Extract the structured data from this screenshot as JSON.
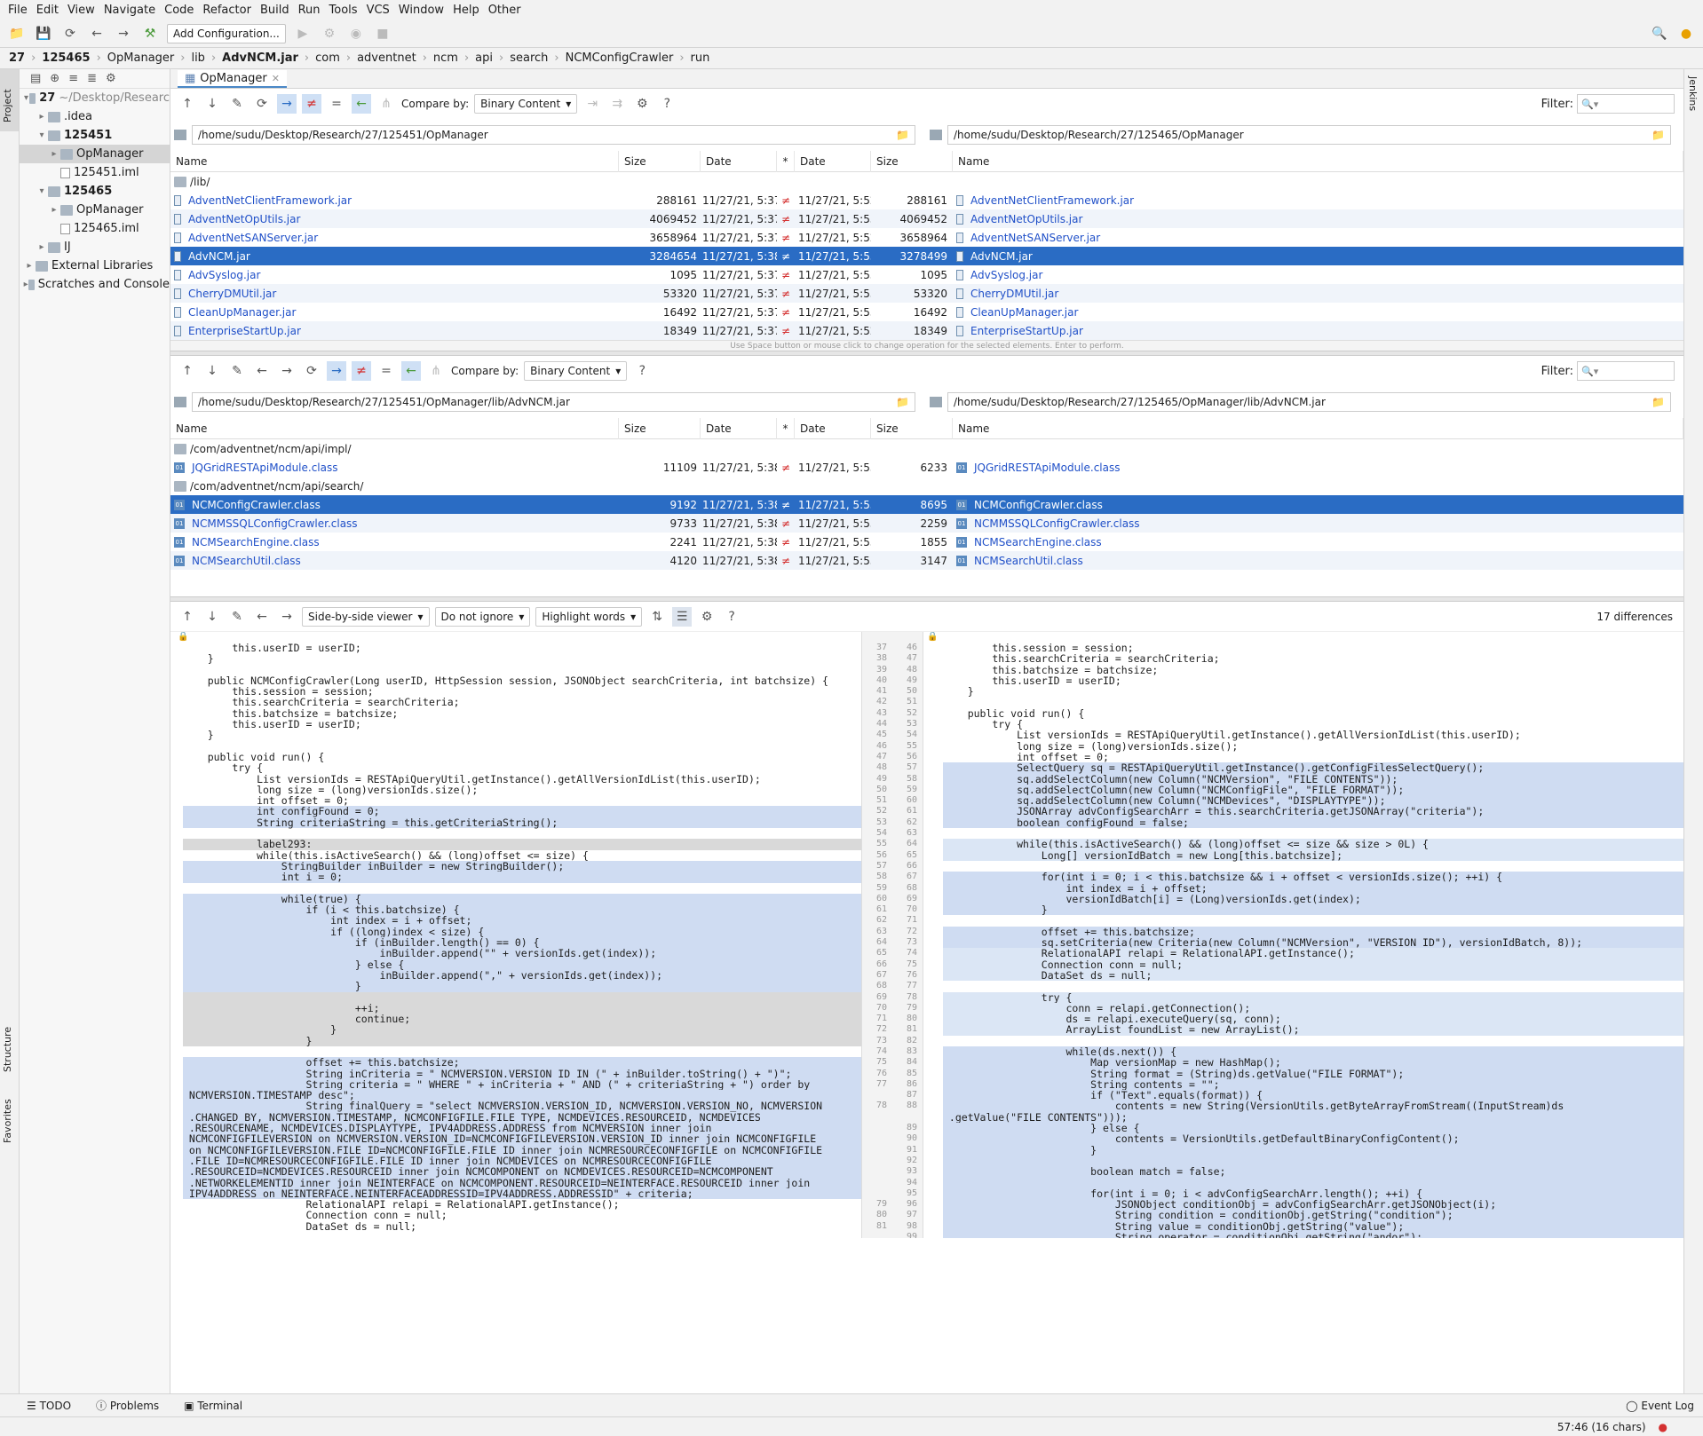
{
  "menu": [
    "File",
    "Edit",
    "View",
    "Navigate",
    "Code",
    "Refactor",
    "Build",
    "Run",
    "Tools",
    "VCS",
    "Window",
    "Help",
    "Other"
  ],
  "toolbar": {
    "add_config": "Add Configuration..."
  },
  "breadcrumb": [
    "27",
    "125465",
    "OpManager",
    "lib",
    "AdvNCM.jar",
    "com",
    "adventnet",
    "ncm",
    "api",
    "search",
    "NCMConfigCrawler",
    "run"
  ],
  "left_tabs": {
    "project": "Project",
    "structure": "Structure",
    "favorites": "Favorites"
  },
  "right_tabs": {
    "jenkins": "Jenkins"
  },
  "project_tree": [
    {
      "label": "27",
      "extra": "~/Desktop/Researc",
      "depth": 0,
      "bold": true
    },
    {
      "label": ".idea",
      "depth": 1
    },
    {
      "label": "125451",
      "depth": 1,
      "bold": true
    },
    {
      "label": "OpManager",
      "depth": 2,
      "selected": true
    },
    {
      "label": "125451.iml",
      "depth": 2
    },
    {
      "label": "125465",
      "depth": 1,
      "bold": true
    },
    {
      "label": "OpManager",
      "depth": 2
    },
    {
      "label": "125465.iml",
      "depth": 2
    },
    {
      "label": "IJ",
      "depth": 1
    },
    {
      "label": "External Libraries",
      "depth": 0
    },
    {
      "label": "Scratches and Console",
      "depth": 0
    }
  ],
  "tab": {
    "label": "OpManager"
  },
  "compare": {
    "label": "Compare by:",
    "value": "Binary Content",
    "filter_label": "Filter:"
  },
  "panel1": {
    "left_path": "/home/sudu/Desktop/Research/27/125451/OpManager",
    "right_path": "/home/sudu/Desktop/Research/27/125465/OpManager",
    "headers": [
      "Name",
      "Size",
      "Date",
      "*",
      "Date",
      "Size",
      "Name"
    ],
    "dir": "/lib/",
    "rows": [
      {
        "name": "AdventNetClientFramework.jar",
        "lsize": "288161",
        "ldate": "11/27/21, 5:37 P...",
        "rdate": "11/27/21, 5:52 P...",
        "rsize": "288161"
      },
      {
        "name": "AdventNetOpUtils.jar",
        "lsize": "4069452",
        "ldate": "11/27/21, 5:37 P...",
        "rdate": "11/27/21, 5:53 P...",
        "rsize": "4069452"
      },
      {
        "name": "AdventNetSANServer.jar",
        "lsize": "3658964",
        "ldate": "11/27/21, 5:37 P...",
        "rdate": "11/27/21, 5:52 P...",
        "rsize": "3658964"
      },
      {
        "name": "AdvNCM.jar",
        "lsize": "3284654",
        "ldate": "11/27/21, 5:38 P...",
        "rdate": "11/27/21, 5:53 P...",
        "rsize": "3278499",
        "selected": true
      },
      {
        "name": "AdvSyslog.jar",
        "lsize": "1095",
        "ldate": "11/27/21, 5:37 P...",
        "rdate": "11/27/21, 5:53 P...",
        "rsize": "1095"
      },
      {
        "name": "CherryDMUtil.jar",
        "lsize": "53320",
        "ldate": "11/27/21, 5:37 P...",
        "rdate": "11/27/21, 5:53 P...",
        "rsize": "53320"
      },
      {
        "name": "CleanUpManager.jar",
        "lsize": "16492",
        "ldate": "11/27/21, 5:37 P...",
        "rdate": "11/27/21, 5:53 P...",
        "rsize": "16492"
      },
      {
        "name": "EnterpriseStartUp.jar",
        "lsize": "18349",
        "ldate": "11/27/21, 5:37 P...",
        "rdate": "11/27/21, 5:52 P...",
        "rsize": "18349"
      }
    ],
    "hint": "Use Space button or mouse click to change operation for the selected elements. Enter to perform."
  },
  "panel2": {
    "left_path": "/home/sudu/Desktop/Research/27/125451/OpManager/lib/AdvNCM.jar",
    "right_path": "/home/sudu/Desktop/Research/27/125465/OpManager/lib/AdvNCM.jar",
    "dir1": "/com/adventnet/ncm/api/impl/",
    "dir2": "/com/adventnet/ncm/api/search/",
    "row_impl": {
      "name": "JQGridRESTApiModule.class",
      "lsize": "11109",
      "ldate": "11/27/21, 5:38 P...",
      "rdate": "11/27/21, 5:53 P...",
      "rsize": "6233"
    },
    "rows": [
      {
        "name": "NCMConfigCrawler.class",
        "lsize": "9192",
        "ldate": "11/27/21, 5:38 P...",
        "rdate": "11/27/21, 5:53 P...",
        "rsize": "8695",
        "selected": true
      },
      {
        "name": "NCMMSSQLConfigCrawler.class",
        "lsize": "9733",
        "ldate": "11/27/21, 5:38 P...",
        "rdate": "11/27/21, 5:53 P...",
        "rsize": "2259"
      },
      {
        "name": "NCMSearchEngine.class",
        "lsize": "2241",
        "ldate": "11/27/21, 5:38 P...",
        "rdate": "11/27/21, 5:53 P...",
        "rsize": "1855"
      },
      {
        "name": "NCMSearchUtil.class",
        "lsize": "4120",
        "ldate": "11/27/21, 5:38 P...",
        "rdate": "11/27/21, 5:53 P...",
        "rsize": "3147"
      }
    ]
  },
  "diff": {
    "viewer": "Side-by-side viewer",
    "ignore": "Do not ignore",
    "highlight": "Highlight words",
    "count": "17 differences",
    "left_lines": [
      {
        "t": "        this.userID = userID;",
        "n": "37"
      },
      {
        "t": "    }",
        "n": "38"
      },
      {
        "t": "",
        "n": "39"
      },
      {
        "t": "    public NCMConfigCrawler(Long userID, HttpSession session, JSONObject searchCriteria, int batchsize) {",
        "n": "40"
      },
      {
        "t": "        this.session = session;",
        "n": "41"
      },
      {
        "t": "        this.searchCriteria = searchCriteria;",
        "n": "42"
      },
      {
        "t": "        this.batchsize = batchsize;",
        "n": "43"
      },
      {
        "t": "        this.userID = userID;",
        "n": "44"
      },
      {
        "t": "    }",
        "n": "45"
      },
      {
        "t": "",
        "n": "46"
      },
      {
        "t": "    public void run() {",
        "n": "47"
      },
      {
        "t": "        try {",
        "n": "48"
      },
      {
        "t": "            List versionIds = RESTApiQueryUtil.getInstance().getAllVersionIdList(this.userID);",
        "n": "49"
      },
      {
        "t": "            long size = (long)versionIds.size();",
        "n": "50"
      },
      {
        "t": "            int offset = 0;",
        "n": "51"
      },
      {
        "t": "            int configFound = 0;",
        "n": "52",
        "c": "chg"
      },
      {
        "t": "            String criteriaString = this.getCriteriaString();",
        "n": "53",
        "c": "chg"
      },
      {
        "t": "",
        "n": "54"
      },
      {
        "t": "            label293:",
        "n": "55",
        "c": "del"
      },
      {
        "t": "            while(this.isActiveSearch() && (long)offset <= size) {",
        "n": "56"
      },
      {
        "t": "                StringBuilder inBuilder = new StringBuilder();",
        "n": "57",
        "c": "chg"
      },
      {
        "t": "                int i = 0;",
        "n": "58",
        "c": "chg"
      },
      {
        "t": "",
        "n": "59"
      },
      {
        "t": "                while(true) {",
        "n": "60",
        "c": "chg"
      },
      {
        "t": "                    if (i < this.batchsize) {",
        "n": "61",
        "c": "chg"
      },
      {
        "t": "                        int index = i + offset;",
        "n": "62",
        "c": "chg"
      },
      {
        "t": "                        if ((long)index < size) {",
        "n": "63",
        "c": "chg"
      },
      {
        "t": "                            if (inBuilder.length() == 0) {",
        "n": "64",
        "c": "chg"
      },
      {
        "t": "                                inBuilder.append(\"\" + versionIds.get(index));",
        "n": "65",
        "c": "chg"
      },
      {
        "t": "                            } else {",
        "n": "66",
        "c": "chg"
      },
      {
        "t": "                                inBuilder.append(\",\" + versionIds.get(index));",
        "n": "67",
        "c": "chg"
      },
      {
        "t": "                            }",
        "n": "68",
        "c": "chg"
      },
      {
        "t": "",
        "n": "69",
        "c": "del"
      },
      {
        "t": "                            ++i;",
        "n": "70",
        "c": "del"
      },
      {
        "t": "                            continue;",
        "n": "71",
        "c": "del"
      },
      {
        "t": "                        }",
        "n": "72",
        "c": "del"
      },
      {
        "t": "                    }",
        "n": "73",
        "c": "del"
      },
      {
        "t": "",
        "n": "74"
      },
      {
        "t": "                    offset += this.batchsize;",
        "n": "75",
        "c": "chg"
      },
      {
        "t": "                    String inCriteria = \" NCMVERSION.VERSION_ID IN (\" + inBuilder.toString() + \")\";",
        "n": "76",
        "c": "chg"
      },
      {
        "t": "                    String criteria = \" WHERE \" + inCriteria + \" AND (\" + criteriaString + \") order by",
        "n": "77",
        "c": "chg"
      },
      {
        "t": " NCMVERSION.TIMESTAMP desc\";",
        "n": "",
        "c": "chg"
      },
      {
        "t": "                    String finalQuery = \"select NCMVERSION.VERSION_ID, NCMVERSION.VERSION_NO, NCMVERSION",
        "n": "78",
        "c": "chg"
      },
      {
        "t": " .CHANGED_BY, NCMVERSION.TIMESTAMP, NCMCONFIGFILE.FILE_TYPE, NCMDEVICES.RESOURCEID, NCMDEVICES",
        "n": "",
        "c": "chg"
      },
      {
        "t": " .RESOURCENAME, NCMDEVICES.DISPLAYTYPE, IPV4ADDRESS.ADDRESS from NCMVERSION inner join",
        "n": "",
        "c": "chg"
      },
      {
        "t": " NCMCONFIGFILEVERSION on NCMVERSION.VERSION_ID=NCMCONFIGFILEVERSION.VERSION_ID inner join NCMCONFIGFILE",
        "n": "",
        "c": "chg"
      },
      {
        "t": " on NCMCONFIGFILEVERSION.FILE_ID=NCMCONFIGFILE.FILE_ID inner join NCMRESOURCECONFIGFILE on NCMCONFIGFILE",
        "n": "",
        "c": "chg"
      },
      {
        "t": " .FILE_ID=NCMRESOURCECONFIGFILE.FILE_ID inner join NCMDEVICES on NCMRESOURCECONFIGFILE",
        "n": "",
        "c": "chg"
      },
      {
        "t": " .RESOURCEID=NCMDEVICES.RESOURCEID inner join NCMCOMPONENT on NCMDEVICES.RESOURCEID=NCMCOMPONENT",
        "n": "",
        "c": "chg"
      },
      {
        "t": " .NETWORKELEMENTID inner join NEINTERFACE on NCMCOMPONENT.RESOURCEID=NEINTERFACE.RESOURCEID inner join",
        "n": "",
        "c": "chg"
      },
      {
        "t": " IPV4ADDRESS on NEINTERFACE.NEINTERFACEADDRESSID=IPV4ADDRESS.ADDRESSID\" + criteria;",
        "n": "",
        "c": "chg"
      },
      {
        "t": "                    RelationalAPI relapi = RelationalAPI.getInstance();",
        "n": "79"
      },
      {
        "t": "                    Connection conn = null;",
        "n": "80"
      },
      {
        "t": "                    DataSet ds = null;",
        "n": "81"
      }
    ],
    "right_lines": [
      {
        "t": "        this.session = session;",
        "n": "46"
      },
      {
        "t": "        this.searchCriteria = searchCriteria;",
        "n": "47"
      },
      {
        "t": "        this.batchsize = batchsize;",
        "n": "48"
      },
      {
        "t": "        this.userID = userID;",
        "n": "49"
      },
      {
        "t": "    }",
        "n": "50"
      },
      {
        "t": "",
        "n": "51"
      },
      {
        "t": "    public void run() {",
        "n": "52"
      },
      {
        "t": "        try {",
        "n": "53"
      },
      {
        "t": "            List versionIds = RESTApiQueryUtil.getInstance().getAllVersionIdList(this.userID);",
        "n": "54"
      },
      {
        "t": "            long size = (long)versionIds.size();",
        "n": "55"
      },
      {
        "t": "            int offset = 0;",
        "n": "56"
      },
      {
        "t": "            SelectQuery sq = RESTApiQueryUtil.getInstance().getConfigFilesSelectQuery();",
        "n": "57",
        "c": "chg"
      },
      {
        "t": "            sq.addSelectColumn(new Column(\"NCMVersion\", \"FILE_CONTENTS\"));",
        "n": "58",
        "c": "chg"
      },
      {
        "t": "            sq.addSelectColumn(new Column(\"NCMConfigFile\", \"FILE_FORMAT\"));",
        "n": "59",
        "c": "chg"
      },
      {
        "t": "            sq.addSelectColumn(new Column(\"NCMDevices\", \"DISPLAYTYPE\"));",
        "n": "60",
        "c": "chg"
      },
      {
        "t": "            JSONArray advConfigSearchArr = this.searchCriteria.getJSONArray(\"criteria\");",
        "n": "61",
        "c": "chg"
      },
      {
        "t": "            boolean configFound = false;",
        "n": "62",
        "c": "chg"
      },
      {
        "t": "",
        "n": "63"
      },
      {
        "t": "            while(this.isActiveSearch() && (long)offset <= size && size > 0L) {",
        "n": "64",
        "c": "ins"
      },
      {
        "t": "                Long[] versionIdBatch = new Long[this.batchsize];",
        "n": "65",
        "c": "ins"
      },
      {
        "t": "",
        "n": "66"
      },
      {
        "t": "                for(int i = 0; i < this.batchsize && i + offset < versionIds.size(); ++i) {",
        "n": "67",
        "c": "chg"
      },
      {
        "t": "                    int index = i + offset;",
        "n": "68",
        "c": "chg"
      },
      {
        "t": "                    versionIdBatch[i] = (Long)versionIds.get(index);",
        "n": "69",
        "c": "chg"
      },
      {
        "t": "                }",
        "n": "70",
        "c": "chg"
      },
      {
        "t": "",
        "n": "71"
      },
      {
        "t": "                offset += this.batchsize;",
        "n": "72",
        "c": "chg"
      },
      {
        "t": "                sq.setCriteria(new Criteria(new Column(\"NCMVersion\", \"VERSION_ID\"), versionIdBatch, 8));",
        "n": "73",
        "c": "chg"
      },
      {
        "t": "                RelationalAPI relapi = RelationalAPI.getInstance();",
        "n": "74",
        "c": "ins"
      },
      {
        "t": "                Connection conn = null;",
        "n": "75",
        "c": "ins"
      },
      {
        "t": "                DataSet ds = null;",
        "n": "76",
        "c": "ins"
      },
      {
        "t": "",
        "n": "77"
      },
      {
        "t": "                try {",
        "n": "78",
        "c": "ins"
      },
      {
        "t": "                    conn = relapi.getConnection();",
        "n": "79",
        "c": "ins"
      },
      {
        "t": "                    ds = relapi.executeQuery(sq, conn);",
        "n": "80",
        "c": "ins"
      },
      {
        "t": "                    ArrayList foundList = new ArrayList();",
        "n": "81",
        "c": "ins"
      },
      {
        "t": "",
        "n": "82"
      },
      {
        "t": "                    while(ds.next()) {",
        "n": "83",
        "c": "chg"
      },
      {
        "t": "                        Map versionMap = new HashMap();",
        "n": "84",
        "c": "chg"
      },
      {
        "t": "                        String format = (String)ds.getValue(\"FILE_FORMAT\");",
        "n": "85",
        "c": "chg"
      },
      {
        "t": "                        String contents = \"\";",
        "n": "86",
        "c": "chg"
      },
      {
        "t": "                        if (\"Text\".equals(format)) {",
        "n": "87",
        "c": "chg"
      },
      {
        "t": "                            contents = new String(VersionUtils.getByteArrayFromStream((InputStream)ds",
        "n": "88",
        "c": "chg"
      },
      {
        "t": " .getValue(\"FILE_CONTENTS\")));",
        "n": "",
        "c": "chg"
      },
      {
        "t": "                        } else {",
        "n": "89",
        "c": "chg"
      },
      {
        "t": "                            contents = VersionUtils.getDefaultBinaryConfigContent();",
        "n": "90",
        "c": "chg"
      },
      {
        "t": "                        }",
        "n": "91",
        "c": "chg"
      },
      {
        "t": "",
        "n": "92",
        "c": "chg"
      },
      {
        "t": "                        boolean match = false;",
        "n": "93",
        "c": "chg"
      },
      {
        "t": "",
        "n": "94",
        "c": "chg"
      },
      {
        "t": "                        for(int i = 0; i < advConfigSearchArr.length(); ++i) {",
        "n": "95",
        "c": "chg"
      },
      {
        "t": "                            JSONObject conditionObj = advConfigSearchArr.getJSONObject(i);",
        "n": "96",
        "c": "chg"
      },
      {
        "t": "                            String condition = conditionObj.getString(\"condition\");",
        "n": "97",
        "c": "chg"
      },
      {
        "t": "                            String value = conditionObj.getString(\"value\");",
        "n": "98",
        "c": "chg"
      },
      {
        "t": "                            String operator = conditionObj.getString(\"andor\");",
        "n": "99",
        "c": "chg"
      }
    ]
  },
  "bottom_tabs": [
    "TODO",
    "Problems",
    "Terminal"
  ],
  "event_log": "Event Log",
  "status_pos": "57:46 (16 chars)"
}
